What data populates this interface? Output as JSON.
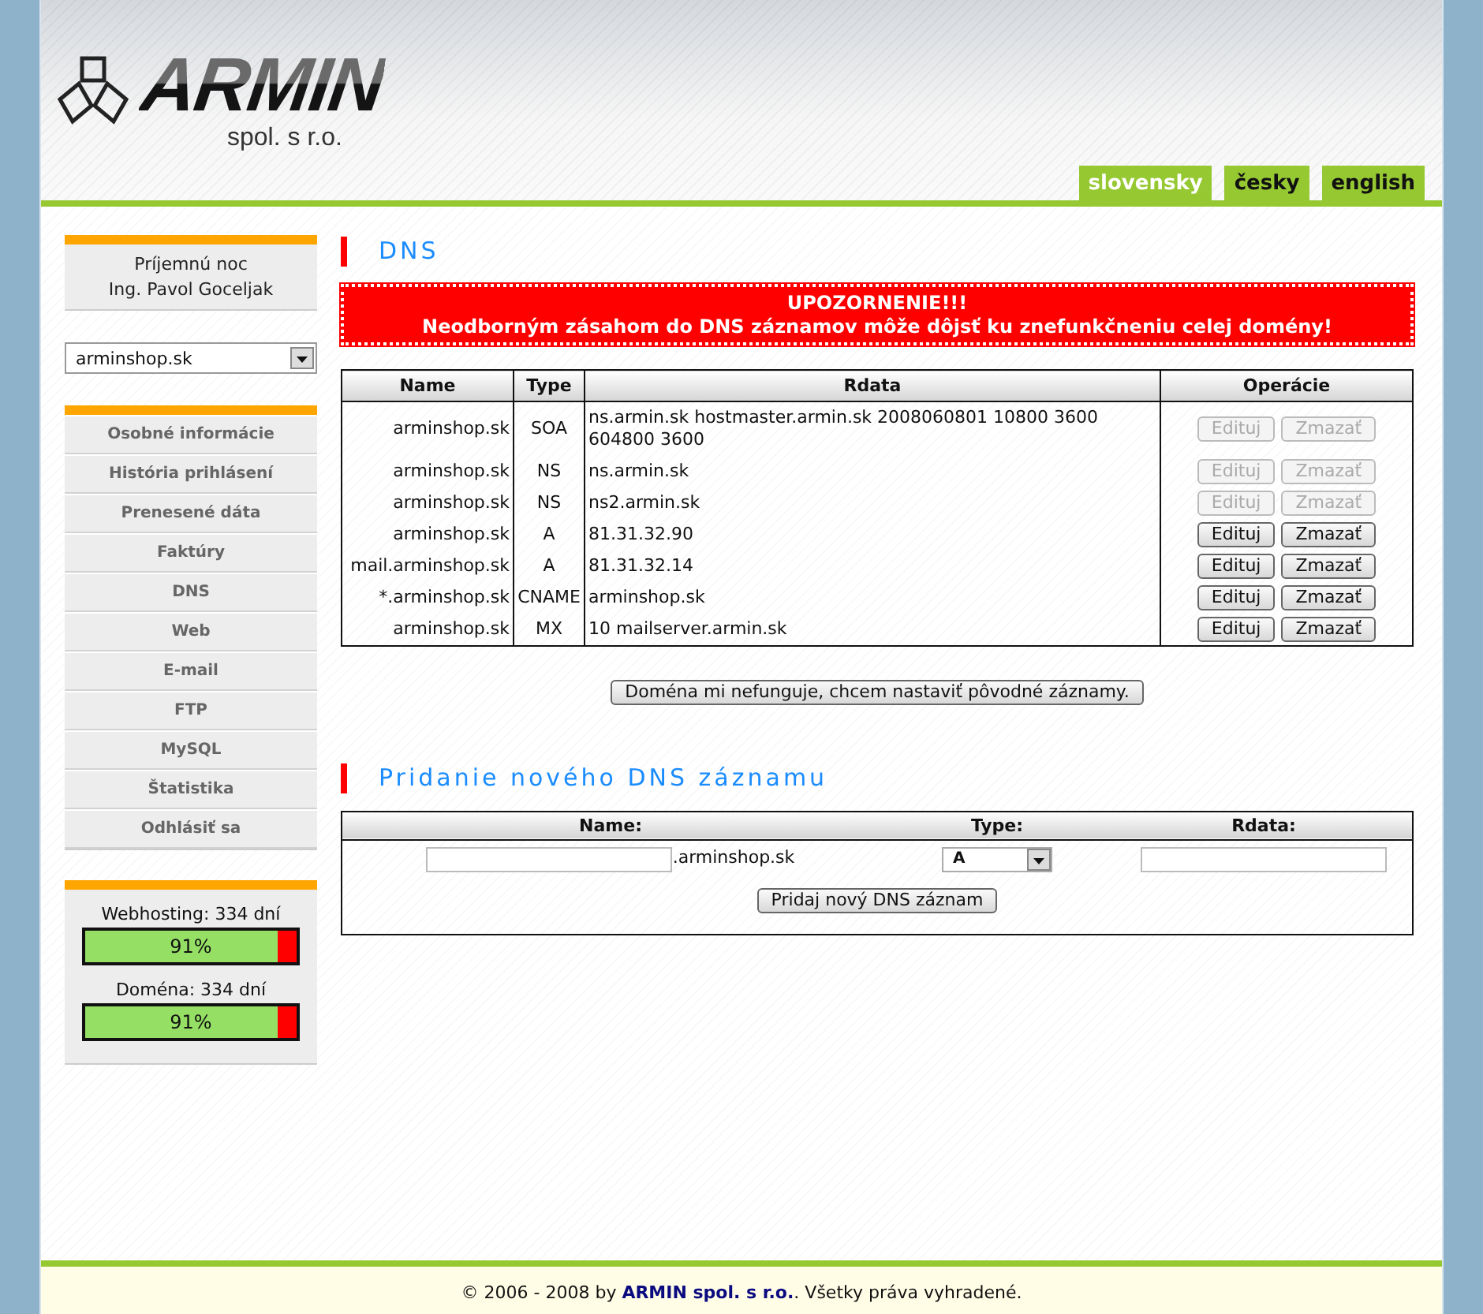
{
  "logo": {
    "name": "ARMIN",
    "subtitle": "spol. s r.o."
  },
  "languages": [
    {
      "label": "slovensky",
      "selected": true
    },
    {
      "label": "česky",
      "selected": false
    },
    {
      "label": "english",
      "selected": false
    }
  ],
  "sidebar": {
    "greeting": "Príjemnú noc",
    "user": "Ing. Pavol Goceljak",
    "domain_select": {
      "value": "arminshop.sk"
    },
    "menu": [
      "Osobné informácie",
      "História prihlásení",
      "Prenesené dáta",
      "Faktúry",
      "DNS",
      "Web",
      "E-mail",
      "FTP",
      "MySQL",
      "Štatistika",
      "Odhlásiť sa"
    ],
    "meters": [
      {
        "label": "Webhosting: 334 dní",
        "level": 0.91,
        "reading": "91%"
      },
      {
        "label": "Doména: 334 dní",
        "level": 0.91,
        "reading": "91%"
      }
    ]
  },
  "dns": {
    "title": "DNS",
    "warning": {
      "title": "UPOZORNENIE!!!",
      "text": "Neodborným zásahom do DNS záznamov môže dôjsť ku znefunkčneniu celej domény!"
    },
    "table": {
      "columns": [
        "Name",
        "Type",
        "Rdata",
        "Operácie"
      ],
      "rows": [
        {
          "name": "arminshop.sk",
          "type": "SOA",
          "rdata": "ns.armin.sk hostmaster.armin.sk 2008060801 10800 3600 604800 3600",
          "actions": [
            {
              "label": "Edituj",
              "disabled": true
            },
            {
              "label": "Zmazať",
              "disabled": true
            }
          ]
        },
        {
          "name": "arminshop.sk",
          "type": "NS",
          "rdata": "ns.armin.sk",
          "actions": [
            {
              "label": "Edituj",
              "disabled": true
            },
            {
              "label": "Zmazať",
              "disabled": true
            }
          ]
        },
        {
          "name": "arminshop.sk",
          "type": "NS",
          "rdata": "ns2.armin.sk",
          "actions": [
            {
              "label": "Edituj",
              "disabled": true
            },
            {
              "label": "Zmazať",
              "disabled": true
            }
          ]
        },
        {
          "name": "arminshop.sk",
          "type": "A",
          "rdata": "81.31.32.90",
          "actions": [
            {
              "label": "Edituj",
              "disabled": false
            },
            {
              "label": "Zmazať",
              "disabled": false
            }
          ]
        },
        {
          "name": "mail.arminshop.sk",
          "type": "A",
          "rdata": "81.31.32.14",
          "actions": [
            {
              "label": "Edituj",
              "disabled": false
            },
            {
              "label": "Zmazať",
              "disabled": false
            }
          ]
        },
        {
          "name": "*.arminshop.sk",
          "type": "CNAME",
          "rdata": "arminshop.sk",
          "actions": [
            {
              "label": "Edituj",
              "disabled": false
            },
            {
              "label": "Zmazať",
              "disabled": false
            }
          ]
        },
        {
          "name": "arminshop.sk",
          "type": "MX",
          "rdata": "10 mailserver.armin.sk",
          "actions": [
            {
              "label": "Edituj",
              "disabled": false
            },
            {
              "label": "Zmazať",
              "disabled": false
            }
          ]
        }
      ]
    },
    "reset_button": "Doména mi nefunguje, chcem nastaviť pôvodné záznamy."
  },
  "add_record": {
    "title": "Pridanie nového DNS záznamu",
    "columns": [
      "Name:",
      "Type:",
      "Rdata:"
    ],
    "name_suffix": ".arminshop.sk",
    "type_select": {
      "value": "A"
    },
    "submit_button": "Pridaj nový DNS záznam"
  },
  "footer": {
    "text": "© 2006 - 2008 by **ARMIN spol. s r.o.**. Všetky práva vyhradené."
  }
}
